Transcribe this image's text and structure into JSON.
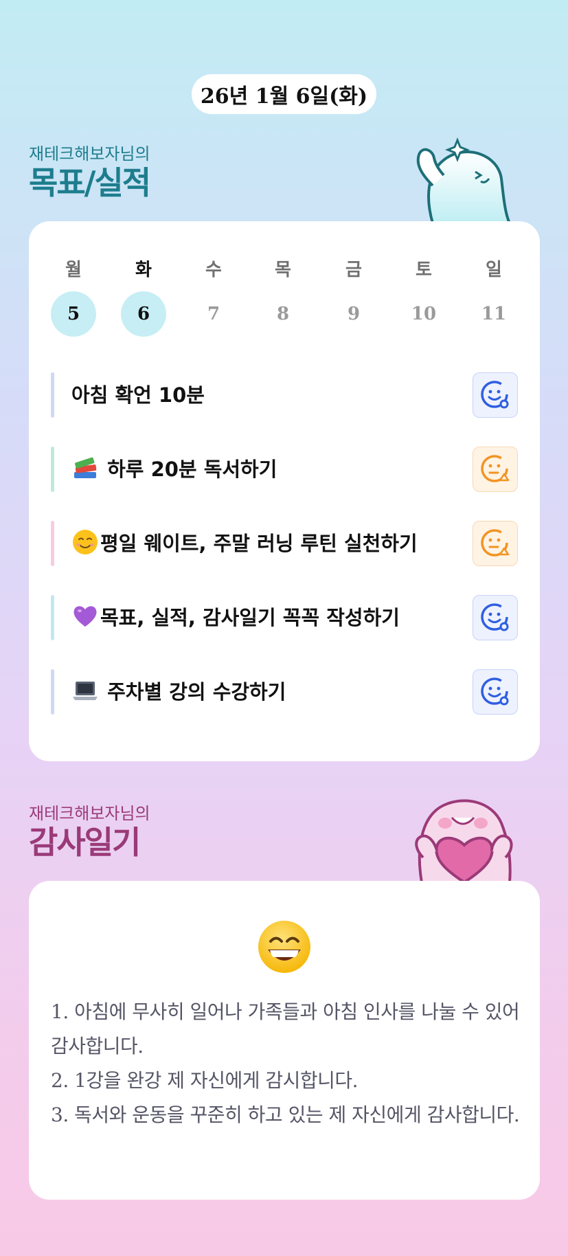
{
  "header": {
    "date": "26년 1월 6일(화)"
  },
  "goals_section": {
    "subtitle": "재테크해보자님의",
    "title": "목표/실적",
    "weekdays": [
      "월",
      "화",
      "수",
      "목",
      "금",
      "토",
      "일"
    ],
    "dates": [
      "5",
      "6",
      "7",
      "8",
      "9",
      "10",
      "11"
    ],
    "active_weekday_index": 1,
    "done_dates": [
      "5",
      "6"
    ],
    "goals": [
      {
        "emoji_icon": "",
        "text": "아침 확언 10분",
        "bar_color": "#cfd8f5",
        "status_icon": "smile-blue-icon"
      },
      {
        "emoji_icon": "books-icon",
        "text": "하루 20분 독서하기",
        "bar_color": "#bfe9dc",
        "status_icon": "meh-orange-icon"
      },
      {
        "emoji_icon": "smile-emoji-icon",
        "text": "평일 웨이트, 주말 러닝 루틴 실천하기",
        "bar_color": "#f7cbe0",
        "status_icon": "meh-orange-icon"
      },
      {
        "emoji_icon": "purple-heart-icon",
        "text": "목표, 실적, 감사일기 꼭꼭 작성하기",
        "bar_color": "#c3e6f5",
        "status_icon": "smile-blue-icon"
      },
      {
        "emoji_icon": "laptop-icon",
        "text": "주차별 강의 수강하기",
        "bar_color": "#cfd8f5",
        "status_icon": "smile-blue-icon"
      }
    ]
  },
  "diary_section": {
    "subtitle": "재테크해보자님의",
    "title": "감사일기",
    "mood_icon": "grinning-face-icon",
    "lines": [
      "1. 아침에 무사히 일어나 가족들과 아침 인사를 나눌 수 있어 감사합니다.",
      "2. 1강을 완강 제 자신에게 감시합니다.",
      "3. 독서와 운동을 꾸준히 하고 있는 제 자신에게 감사합니다."
    ]
  },
  "colors": {
    "accent_teal": "#1e7d8d",
    "accent_plum": "#9b3a78",
    "status_blue": "#2f5ee0",
    "status_orange": "#f29422",
    "done_date_bg": "#c6eef4"
  }
}
